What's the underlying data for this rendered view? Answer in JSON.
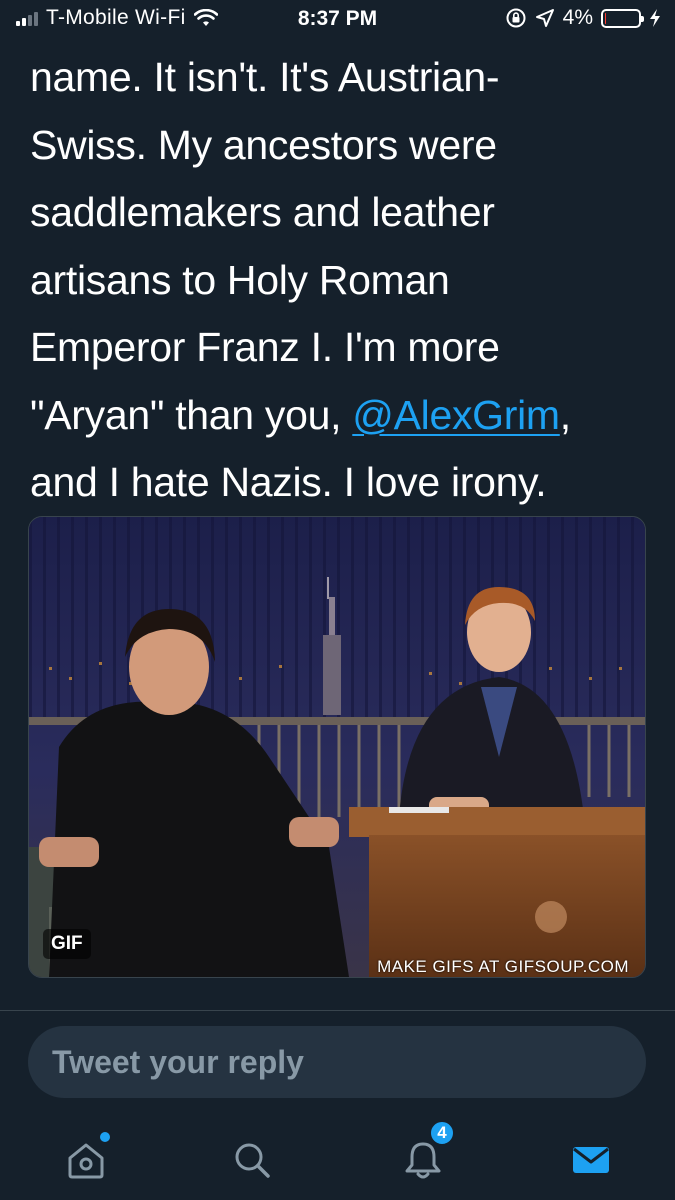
{
  "status_bar": {
    "carrier": "T-Mobile Wi-Fi",
    "time": "8:37 PM",
    "battery_percent": "4%",
    "battery_level": 0.04,
    "icons": [
      "signal-icon",
      "wifi-icon",
      "orientation-lock-icon",
      "location-arrow-icon",
      "battery-icon",
      "charging-bolt-icon"
    ]
  },
  "tweet": {
    "lines": [
      "name. It isn't. It's Austrian-",
      "Swiss. My ancestors were",
      "saddlemakers and leather",
      "artisans to Holy Roman",
      "Emperor Franz I. I'm more"
    ],
    "line6_before": "\"Aryan\" than you, ",
    "mention": "@AlexGrim",
    "line6_after": ",",
    "line7": "and I hate Nazis. I love irony."
  },
  "media": {
    "badge": "GIF",
    "watermark": "MAKE GIFS AT GIFSOUP.COM"
  },
  "reply": {
    "placeholder": "Tweet your reply"
  },
  "tabbar": {
    "notification_count": "4",
    "icons": [
      "home-icon",
      "search-icon",
      "notifications-bell-icon",
      "messages-envelope-icon"
    ]
  },
  "colors": {
    "background": "#15202b",
    "accent": "#1da1f2",
    "reply_field": "#253341",
    "placeholder": "#8899a6"
  }
}
